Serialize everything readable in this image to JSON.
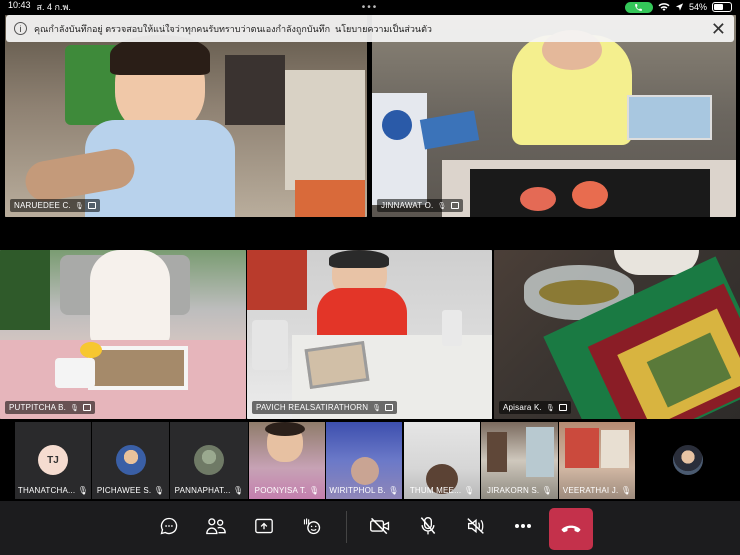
{
  "status_bar": {
    "time": "10:43",
    "date": "ส. 4 ก.พ.",
    "dots": "•••",
    "battery": "54%"
  },
  "banner": {
    "message": "คุณกำลังบันทึกอยู่ ตรวจสอบให้แน่ใจว่าทุกคนรับทราบว่าตนเองกำลังถูกบันทึก",
    "link": "นโยบายความเป็นส่วนตัว",
    "close": "✕"
  },
  "tiles": [
    {
      "name": "NARUEDEE C."
    },
    {
      "name": "JINNAWAT O."
    },
    {
      "name": "PUTPITCHA B."
    },
    {
      "name": "PAVICH  REALSATIRATHORN"
    },
    {
      "name": "Apisara K."
    }
  ],
  "strip": [
    {
      "name": "THANATCHA...",
      "initials": "TJ"
    },
    {
      "name": "PICHAWEE S."
    },
    {
      "name": "PANNAPHAT..."
    },
    {
      "name": "POONYISA T."
    },
    {
      "name": "WIRITPHOL B."
    },
    {
      "name": "THUM  MEE..."
    },
    {
      "name": "JIRAKORN S."
    },
    {
      "name": "VEERATHAI J."
    }
  ],
  "colors": {
    "end_call": "#c4314b",
    "call_pill": "#34c759",
    "toolbar_bg": "#1c1c1e"
  }
}
